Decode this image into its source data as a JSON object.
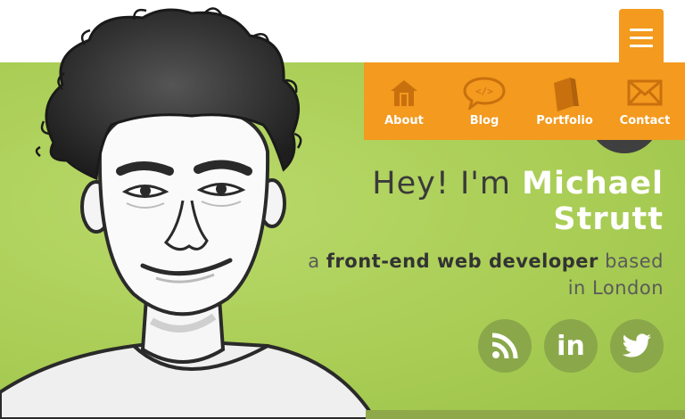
{
  "menu": {
    "toggle_icon": "hamburger-menu-icon"
  },
  "nav": {
    "items": [
      {
        "label": "About",
        "icon": "house-icon"
      },
      {
        "label": "Blog",
        "icon": "code-speech-bubble-icon"
      },
      {
        "label": "Portfolio",
        "icon": "book-icon"
      },
      {
        "label": "Contact",
        "icon": "envelope-icon"
      }
    ]
  },
  "hero": {
    "greeting": "Hey! I'm ",
    "name": "Michael Strutt",
    "tagline_prefix": "a ",
    "tagline_strong": "front-end web developer",
    "tagline_suffix": " based in London"
  },
  "social": [
    {
      "icon": "rss-icon"
    },
    {
      "icon": "linkedin-icon"
    },
    {
      "icon": "twitter-icon"
    }
  ],
  "colors": {
    "accent": "#f39a1f",
    "hero_green": "#a9cd55",
    "social_circle": "#8aa84a",
    "name_white": "#ffffff",
    "text_dark": "#3a3a3a"
  }
}
